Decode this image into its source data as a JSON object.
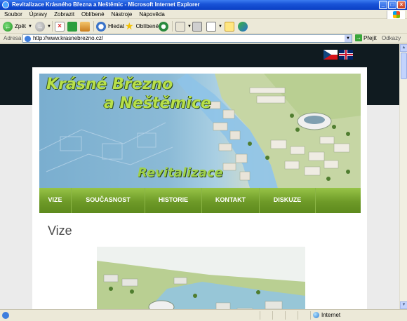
{
  "window": {
    "title": "Revitalizace Krásného Března a Neštěmic - Microsoft Internet Explorer",
    "minimize": "_",
    "maximize": "□",
    "close": "×"
  },
  "menu": {
    "items": [
      "Soubor",
      "Úpravy",
      "Zobrazit",
      "Oblíbené",
      "Nástroje",
      "Nápověda"
    ]
  },
  "toolbar": {
    "back_label": "Zpět",
    "search_label": "Hledat",
    "favorites_label": "Oblíbené"
  },
  "address": {
    "label": "Adresa",
    "url": "http://www.krasnebrezno.cz/",
    "go_label": "Přejít",
    "links_label": "Odkazy"
  },
  "site": {
    "hero": {
      "title_line1": "Krásné Březno",
      "title_line2": "a Neštěmice",
      "subtitle": "Revitalizace"
    },
    "nav": [
      "VIZE",
      "SOUČASNOST",
      "HISTORIE",
      "KONTAKT",
      "DISKUZE"
    ],
    "heading": "Vize"
  },
  "status": {
    "zone": "Internet"
  },
  "colors": {
    "titlebar": "#0a3fc4",
    "nav_green": "#6e9a28",
    "hero_title": "#b8e04a",
    "site_topbar": "#101b20"
  }
}
